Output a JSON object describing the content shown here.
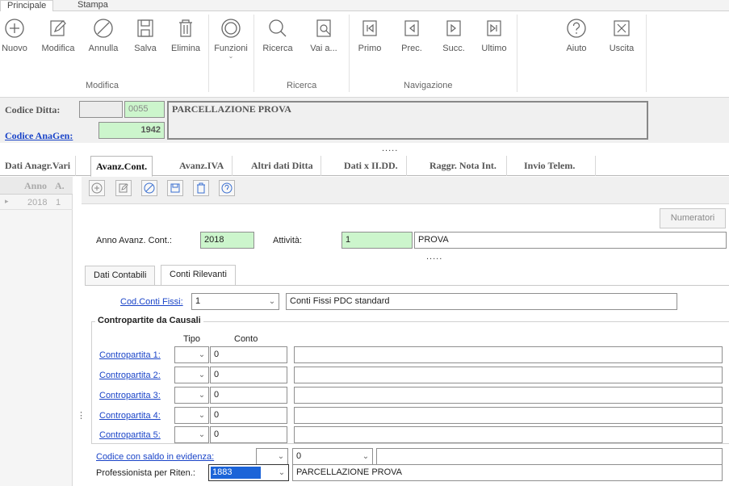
{
  "ribbon_tabs": [
    "Principale",
    "Stampa"
  ],
  "ribbon": {
    "buttons": [
      {
        "label": "Nuovo",
        "icon": "plus-circle-icon"
      },
      {
        "label": "Modifica",
        "icon": "pencil-icon"
      },
      {
        "label": "Annulla",
        "icon": "cancel-circle-icon"
      },
      {
        "label": "Salva",
        "icon": "floppy-icon"
      },
      {
        "label": "Elimina",
        "icon": "trash-icon"
      },
      {
        "label": "Funzioni",
        "icon": "functions-ring-icon"
      },
      {
        "label": "Ricerca",
        "icon": "search-icon"
      },
      {
        "label": "Vai a...",
        "icon": "goto-search-icon"
      },
      {
        "label": "Primo",
        "icon": "first-record-icon"
      },
      {
        "label": "Prec.",
        "icon": "prev-record-icon"
      },
      {
        "label": "Succ.",
        "icon": "next-record-icon"
      },
      {
        "label": "Ultimo",
        "icon": "last-record-icon"
      },
      {
        "label": "Aiuto",
        "icon": "help-icon"
      },
      {
        "label": "Uscita",
        "icon": "exit-icon"
      }
    ],
    "groups": [
      "Modifica",
      "Ricerca",
      "Navigazione"
    ]
  },
  "header": {
    "codice_ditta_label": "Codice Ditta:",
    "codice_ditta_prefix": "",
    "codice_ditta_value": "0055",
    "ragione_sociale": "PARCELLAZIONE PROVA",
    "codice_anagen_label": "Codice AnaGen:",
    "codice_anagen_value": "1942",
    "more_dots": "....."
  },
  "tabs": [
    "Dati Anagr.Vari",
    "Avanz.Cont.",
    "Avanz.IVA",
    "Altri dati Ditta",
    "Dati x II.DD.",
    "Raggr. Nota Int.",
    "Invio Telem."
  ],
  "active_tab": "Avanz.Cont.",
  "grid": {
    "columns": [
      "Anno",
      "A."
    ],
    "rows": [
      {
        "anno": "2018",
        "a": "1"
      }
    ]
  },
  "detail": {
    "numeratori_label": "Numeratori",
    "anno_label": "Anno Avanz. Cont.:",
    "anno_value": "2018",
    "attivita_label": "Attività:",
    "attivita_value": "1",
    "attivita_desc": "PROVA",
    "more_dots": ".....",
    "subtabs": [
      "Dati Contabili",
      "Conti Rilevanti"
    ],
    "active_subtab": "Conti Rilevanti",
    "cod_conti_label": "Cod.Conti Fissi:",
    "cod_conti_value": "1",
    "cod_conti_desc": "Conti Fissi PDC standard",
    "contropartite_title": "Contropartite da Causali",
    "col_tipo": "Tipo",
    "col_conto": "Conto",
    "contropartite": [
      {
        "label": "Contropartita 1:",
        "conto": "0",
        "desc": ""
      },
      {
        "label": "Contropartita 2:",
        "conto": "0",
        "desc": ""
      },
      {
        "label": "Contropartita 3:",
        "conto": "0",
        "desc": ""
      },
      {
        "label": "Contropartita 4:",
        "conto": "0",
        "desc": ""
      },
      {
        "label": "Contropartita 5:",
        "conto": "0",
        "desc": ""
      }
    ],
    "saldo_label": "Codice con saldo in evidenza:",
    "saldo_value": "0",
    "prof_label": "Professionista per Riten.:",
    "prof_value": "1883",
    "prof_desc": "PARCELLAZIONE PROVA"
  }
}
